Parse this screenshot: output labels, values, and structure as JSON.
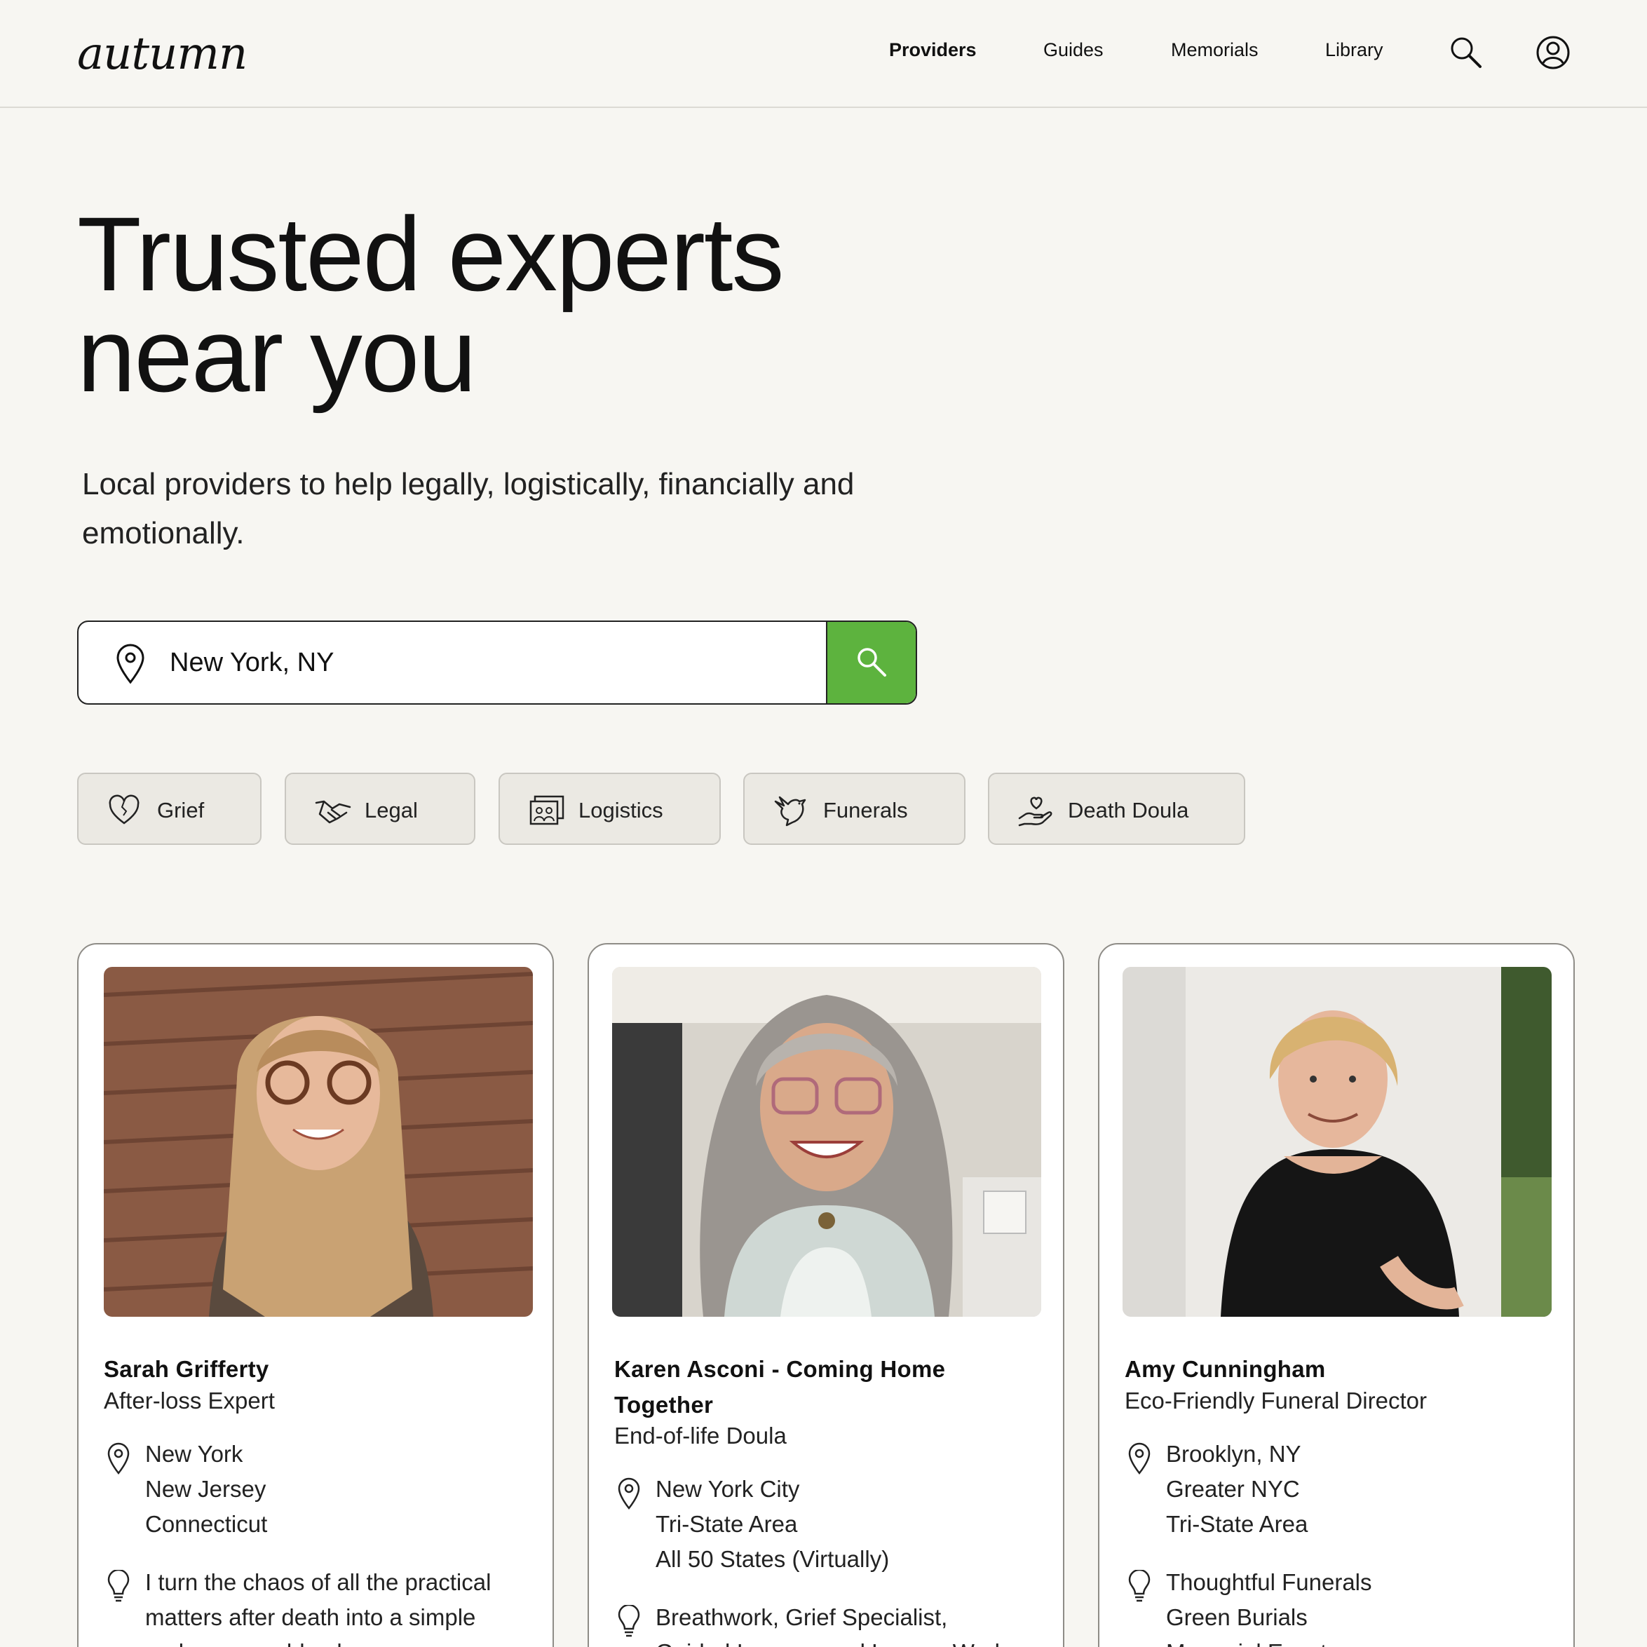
{
  "header": {
    "logo": "autumn",
    "nav": [
      "Providers",
      "Guides",
      "Memorials",
      "Library"
    ]
  },
  "hero": {
    "title_line1": "Trusted experts",
    "title_line2": "near you",
    "subtitle_line1": "Local providers to help legally, logistically, financially and",
    "subtitle_line2": "emotionally."
  },
  "search": {
    "value": "New York, NY"
  },
  "chips": [
    "Grief",
    "Legal",
    "Logistics",
    "Funerals",
    "Death Doula"
  ],
  "colors": {
    "accent_green": "#5db33e",
    "background": "#f7f6f2"
  },
  "providers": [
    {
      "name": "Sarah Grifferty",
      "role": "After-loss Expert",
      "locations": [
        "New York",
        "New Jersey",
        "Connecticut"
      ],
      "about": [
        "I turn the chaos of all the practical",
        "matters after death into a simple",
        "and manageable plan"
      ]
    },
    {
      "name": "Karen Asconi - Coming Home Together",
      "role": "End-of-life Doula",
      "locations": [
        "New York City",
        "Tri-State Area",
        "All 50 States (Virtually)"
      ],
      "about": [
        "Breathwork, Grief Specialist,",
        "Guided Imagery and Legacy Work"
      ]
    },
    {
      "name": "Amy Cunningham",
      "role": "Eco-Friendly Funeral Director",
      "locations": [
        "Brooklyn, NY",
        "Greater NYC",
        "Tri-State Area"
      ],
      "about": [
        "Thoughtful Funerals",
        "Green Burials",
        "Memorial Events"
      ]
    }
  ]
}
